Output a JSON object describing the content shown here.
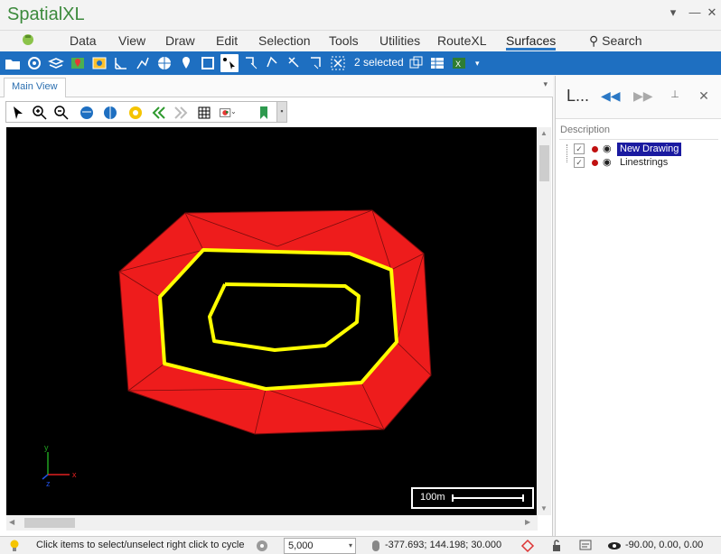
{
  "app": {
    "title": "SpatialXL"
  },
  "window": {
    "minimize": "—",
    "close": "✕",
    "menu": "▾"
  },
  "ribbon": {
    "tabs": [
      "Data",
      "View",
      "Draw",
      "Edit",
      "Selection",
      "Tools",
      "Utilities",
      "RouteXL",
      "Surfaces"
    ],
    "active_tab": "Surfaces",
    "search_label": "Search"
  },
  "toolbar": {
    "selected_count": "2 selected"
  },
  "document": {
    "tab_label": "Main View",
    "dropdown": "▾"
  },
  "map": {
    "scale_label": "100m",
    "axis": {
      "x": "x",
      "y": "y",
      "z": "z"
    },
    "colors": {
      "background": "#000000",
      "surface": "#ee1c1c",
      "linestring": "#ffff00",
      "triangle_edges": "#7a0d0d"
    }
  },
  "layers_panel": {
    "title": "L...",
    "description_header": "Description",
    "layers": [
      {
        "name": "New Drawing",
        "checked": true,
        "visible": true,
        "selected": true
      },
      {
        "name": "Linestrings",
        "checked": true,
        "visible": true,
        "selected": false
      }
    ]
  },
  "status": {
    "hint": "Click items to select/unselect right click to cycle",
    "scale_value": "5,000",
    "coordinates": "-377.693; 144.198; 30.000",
    "camera": "-90.00, 0.00, 0.00"
  },
  "colors": {
    "accent": "#1e6fc1",
    "title_green": "#3c8a3c",
    "selection_blue": "#1a1aa0"
  }
}
